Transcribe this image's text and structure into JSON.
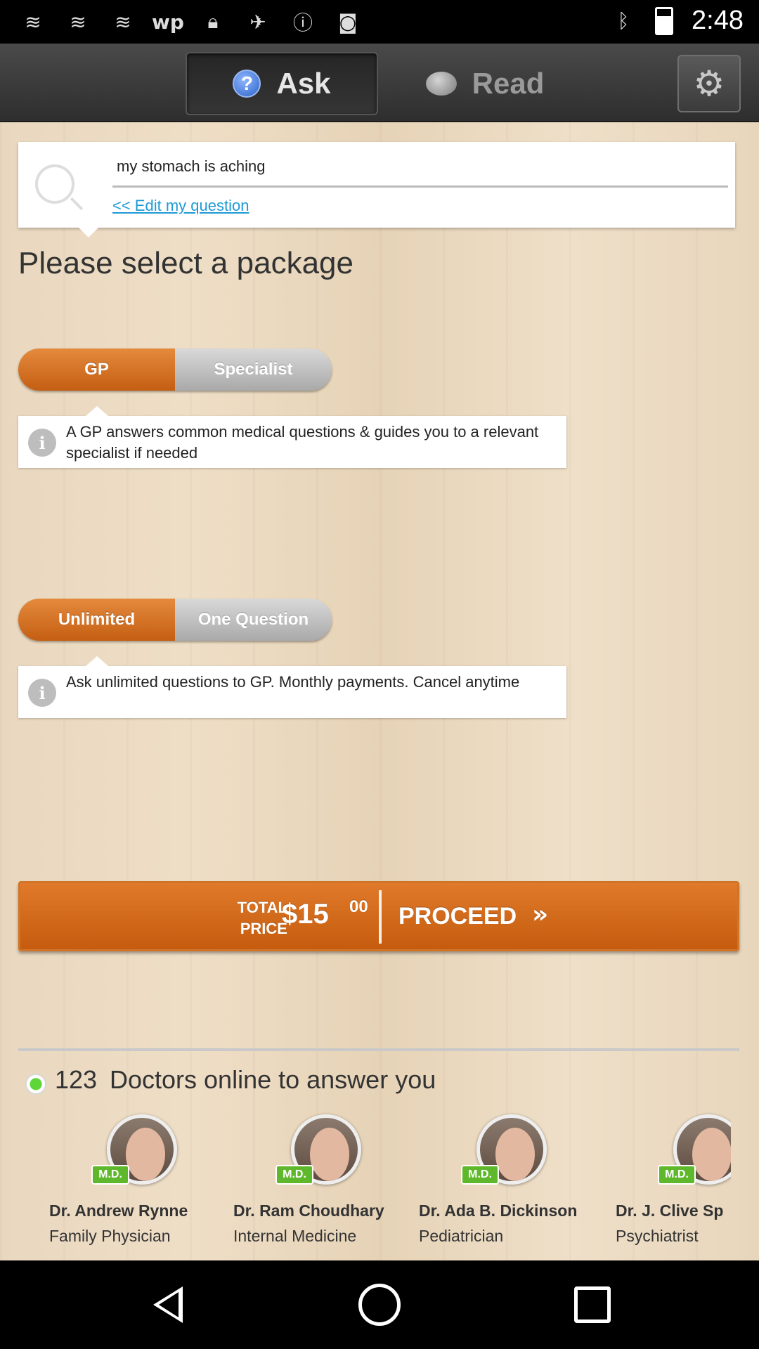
{
  "status_bar": {
    "time": "2:48",
    "left_icons": [
      "notification-icon",
      "notification-icon",
      "notification-icon",
      "wp-icon",
      "lock-icon",
      "fake-gps-icon",
      "info-icon",
      "android-icon"
    ],
    "right_icons": [
      "bluetooth-icon",
      "battery-icon"
    ],
    "wp_text": "wp"
  },
  "topbar": {
    "ask_label": "Ask",
    "read_label": "Read",
    "ask_icon": "?",
    "accent": "#2c63c7"
  },
  "question": {
    "text": "my stomach is aching",
    "edit_link": "<< Edit my question"
  },
  "heading": "Please select a package",
  "package_type": {
    "options": [
      "GP",
      "Specialist"
    ],
    "selected": "GP",
    "info": "A GP answers common medical questions & guides you to a relevant specialist if needed"
  },
  "plan": {
    "options": [
      "Unlimited",
      "One Question"
    ],
    "selected": "Unlimited",
    "info": "Ask unlimited questions to GP. Monthly payments. Cancel anytime"
  },
  "total": {
    "label_line1": "TOTAL",
    "label_line2": "PRICE",
    "amount": "$15",
    "cents": "00",
    "proceed": "PROCEED",
    "proceed_icon": "»",
    "color": "#c55b0e"
  },
  "online": {
    "count": "123",
    "text": "Doctors online to answer you",
    "status_color": "#5ed63a"
  },
  "doctors": [
    {
      "badge": "M.D.",
      "name": "Dr. Andrew Rynne",
      "specialty": "Family Physician"
    },
    {
      "badge": "M.D.",
      "name": "Dr. Ram Choudhary",
      "specialty": "Internal Medicine"
    },
    {
      "badge": "M.D.",
      "name": "Dr. Ada B. Dickinson",
      "specialty": "Pediatrician"
    },
    {
      "badge": "M.D.",
      "name": "Dr. J. Clive Sp",
      "specialty": "Psychiatrist"
    }
  ]
}
